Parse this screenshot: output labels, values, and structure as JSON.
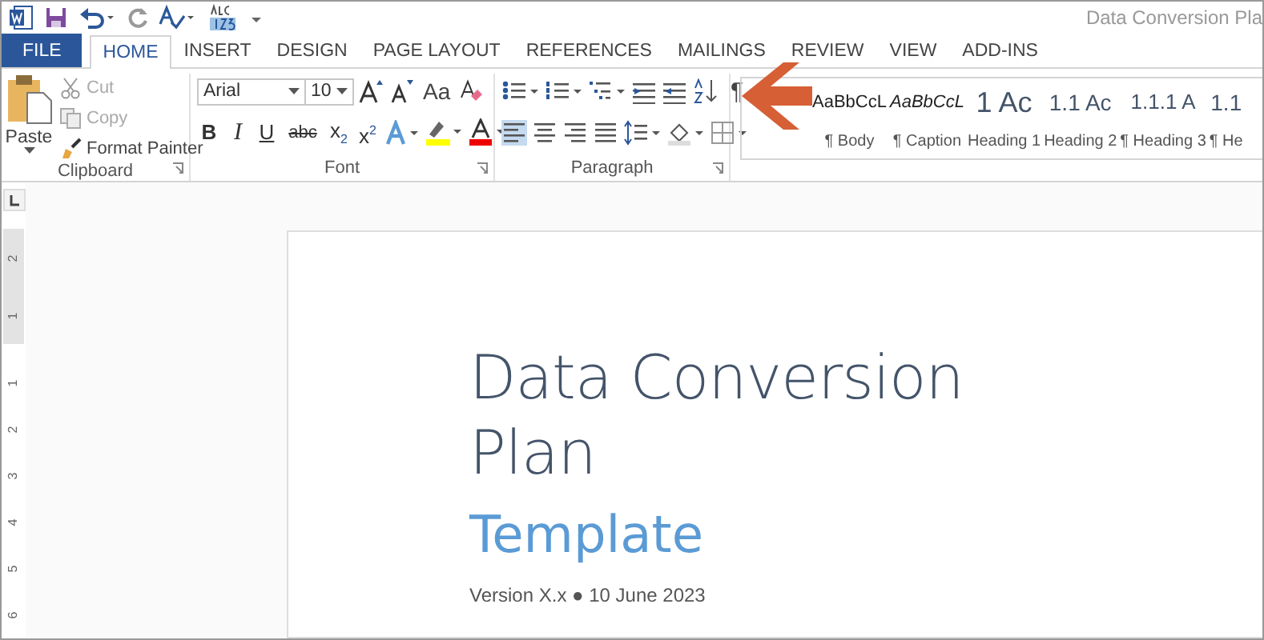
{
  "window": {
    "title": "Data Conversion Pla"
  },
  "tabs": [
    {
      "label": "FILE",
      "kind": "file",
      "selected": false
    },
    {
      "label": "HOME",
      "kind": "tab",
      "selected": true
    },
    {
      "label": "INSERT",
      "kind": "tab",
      "selected": false
    },
    {
      "label": "DESIGN",
      "kind": "tab",
      "selected": false
    },
    {
      "label": "PAGE LAYOUT",
      "kind": "tab",
      "selected": false
    },
    {
      "label": "REFERENCES",
      "kind": "tab",
      "selected": false
    },
    {
      "label": "MAILINGS",
      "kind": "tab",
      "selected": false
    },
    {
      "label": "REVIEW",
      "kind": "tab",
      "selected": false
    },
    {
      "label": "VIEW",
      "kind": "tab",
      "selected": false
    },
    {
      "label": "ADD-INS",
      "kind": "tab",
      "selected": false
    }
  ],
  "clipboard": {
    "paste": "Paste",
    "cut": {
      "label": "Cut",
      "disabled": true
    },
    "copy": {
      "label": "Copy",
      "disabled": true
    },
    "format_painter": {
      "label": "Format Painter",
      "disabled": false
    },
    "group_label": "Clipboard"
  },
  "font": {
    "font_name": "Arial",
    "font_size": "10",
    "case_button": "Aa",
    "format_buttons": [
      "B",
      "I",
      "U",
      "abc",
      "x$_{2}$",
      "x$^{2}$"
    ],
    "group_label": "Font"
  },
  "paragraph": {
    "show_marks": "¶",
    "group_label": "Paragraph"
  },
  "styles": [
    {
      "preview": "AaBbCcL",
      "name": "¶ Body",
      "kind": "body"
    },
    {
      "preview": "AaBbCcL",
      "name": "¶ Caption",
      "kind": "caption"
    },
    {
      "preview": "1 Ac",
      "name": "Heading 1",
      "kind": "h1"
    },
    {
      "preview": "1.1 Ac",
      "name": "Heading 2",
      "kind": "h2"
    },
    {
      "preview": "1.1.1 A",
      "name": "¶ Heading 3",
      "kind": "h3"
    },
    {
      "preview": "1.1",
      "name": "¶ He",
      "kind": "h2"
    }
  ],
  "ruler": {
    "labels": [
      "2",
      "1",
      "1",
      "2",
      "3",
      "4",
      "5",
      "6"
    ]
  },
  "document": {
    "title": "Data Conversion Plan",
    "subtitle": "Template",
    "version_line": "Version X.x ● 10 June 2023"
  }
}
